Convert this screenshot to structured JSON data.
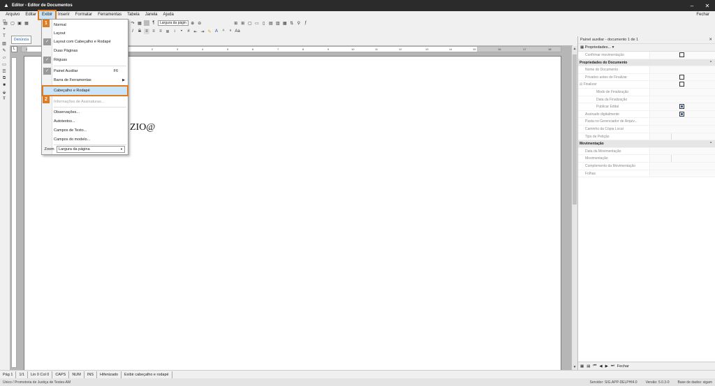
{
  "window": {
    "title": "Editor - Editor de Documentos",
    "controls": {
      "minimize": "–",
      "close": "✕"
    }
  },
  "menubar": {
    "items": [
      "Arquivo",
      "Editar",
      "Exibir",
      "Inserir",
      "Formatar",
      "Ferramentas",
      "Tabela",
      "Janela",
      "Ajuda"
    ],
    "active": "Exibir",
    "right_label": "Fechar"
  },
  "toolbar": {
    "zoom_combo": "Largura da págin",
    "icons": [
      "new-icon",
      "open-icon",
      "save-icon",
      "print-icon",
      "undo-icon",
      "redo-icon",
      "table-icon",
      "pilcrow-icon",
      "zoom-in-icon",
      "zoom-out-icon",
      "bold-icon",
      "italic-icon",
      "strike-icon",
      "align-left-icon",
      "align-center-icon",
      "align-right-icon",
      "justify-icon",
      "list-bullet-icon",
      "list-number-icon",
      "indent-icon",
      "outdent-icon",
      "highlight-icon",
      "font-color-icon"
    ]
  },
  "document": {
    "tab_label": "Denúncia",
    "visible_text": "ZIO@",
    "ruler_marks": [
      "2",
      "1",
      "1",
      "2",
      "3",
      "4",
      "5",
      "6",
      "7",
      "8",
      "9",
      "10",
      "11",
      "12",
      "13",
      "14",
      "15",
      "16",
      "17",
      "18"
    ]
  },
  "view_menu": {
    "items": [
      {
        "label": "Normal",
        "checked": false,
        "shortcut": "",
        "submenu": false,
        "disabled": false
      },
      {
        "label": "Layout",
        "checked": false,
        "shortcut": "",
        "submenu": false,
        "disabled": false
      },
      {
        "label": "Layout com Cabeçalho e Rodapé",
        "checked": true,
        "shortcut": "",
        "submenu": false,
        "disabled": false
      },
      {
        "label": "Duas Páginas",
        "checked": false,
        "shortcut": "",
        "submenu": false,
        "disabled": false
      },
      {
        "label": "Réguas",
        "checked": true,
        "shortcut": "",
        "submenu": false,
        "disabled": false
      },
      {
        "label": "Painel Auxiliar",
        "checked": true,
        "shortcut": "F6",
        "submenu": false,
        "disabled": false
      },
      {
        "label": "Barra de Ferramentas",
        "checked": false,
        "shortcut": "",
        "submenu": true,
        "disabled": false
      },
      {
        "label": "Cabeçalho e Rodapé",
        "checked": false,
        "shortcut": "",
        "submenu": false,
        "disabled": false,
        "highlighted": true
      },
      {
        "label": "Informações de Assinaturas...",
        "checked": false,
        "shortcut": "",
        "submenu": false,
        "disabled": true
      },
      {
        "label": "Observações...",
        "checked": false,
        "shortcut": "",
        "submenu": false,
        "disabled": false
      },
      {
        "label": "Autotextos...",
        "checked": false,
        "shortcut": "",
        "submenu": false,
        "disabled": false
      },
      {
        "label": "Campos de Texto...",
        "checked": false,
        "shortcut": "",
        "submenu": false,
        "disabled": false
      },
      {
        "label": "Campos do modelo...",
        "checked": false,
        "shortcut": "",
        "submenu": false,
        "disabled": false
      }
    ],
    "zoom_label": "Zoom",
    "zoom_value": "Largura da página"
  },
  "steps": [
    "1",
    "2"
  ],
  "panel": {
    "title": "Painel auxiliar - documento 1 de 1",
    "combo": "Propriedades...",
    "rows": [
      {
        "label": "Confirmar movimentação",
        "type": "checkbox",
        "checked": false,
        "section": false,
        "indent": 0
      },
      {
        "label": "Propriedades do Documento",
        "type": "section",
        "section": true
      },
      {
        "label": "Nome do Documento",
        "type": "text",
        "section": false,
        "indent": 0
      },
      {
        "label": "Privativo antes de Finalizar",
        "type": "checkbox",
        "checked": false,
        "section": false,
        "indent": 0
      },
      {
        "label": "⊟ Finalizar",
        "type": "checkbox",
        "checked": false,
        "section": false,
        "indent": -1
      },
      {
        "label": "Modo de Finalização",
        "type": "text",
        "section": false,
        "indent": 2
      },
      {
        "label": "Data da Finalização",
        "type": "text",
        "section": false,
        "indent": 2
      },
      {
        "label": "Publicar Edital",
        "type": "checkbox",
        "checked": true,
        "section": false,
        "indent": 2
      },
      {
        "label": "Assinado digitalmente",
        "type": "checkbox",
        "checked": true,
        "section": false,
        "indent": 0
      },
      {
        "label": "Pasta no Gerenciador de Arquiv...",
        "type": "text",
        "section": false,
        "indent": 0
      },
      {
        "label": "Caminho da Cópia Local",
        "type": "text",
        "section": false,
        "indent": 0
      },
      {
        "label": "Tipo de Petição",
        "type": "split",
        "section": false,
        "indent": 0
      },
      {
        "label": "Movimentação",
        "type": "section",
        "section": true
      },
      {
        "label": "Data da Movimentação",
        "type": "text",
        "section": false,
        "indent": 0
      },
      {
        "label": "Movimentação",
        "type": "split",
        "section": false,
        "indent": 0
      },
      {
        "label": "Complemento da Movimentação",
        "type": "text",
        "section": false,
        "indent": 0
      },
      {
        "label": "Folhas",
        "type": "text",
        "section": false,
        "indent": 0
      }
    ],
    "bottom": {
      "close_label": "Fechar"
    }
  },
  "statusbar": {
    "cells": [
      "Pág 1",
      "1/1",
      "Lin 0  Col 0",
      "CAPS",
      "NUM",
      "INS",
      "Hifenizado",
      "Exibir cabeçalho e rodapé"
    ]
  },
  "footer": {
    "left": "Único / Promotoria de Justiça de Testes-AM",
    "server": "Servidor: SIG.APP-DELPHI4.0",
    "version": "Versão: 5.0.3-0",
    "db": "Base de dados: sigam"
  }
}
